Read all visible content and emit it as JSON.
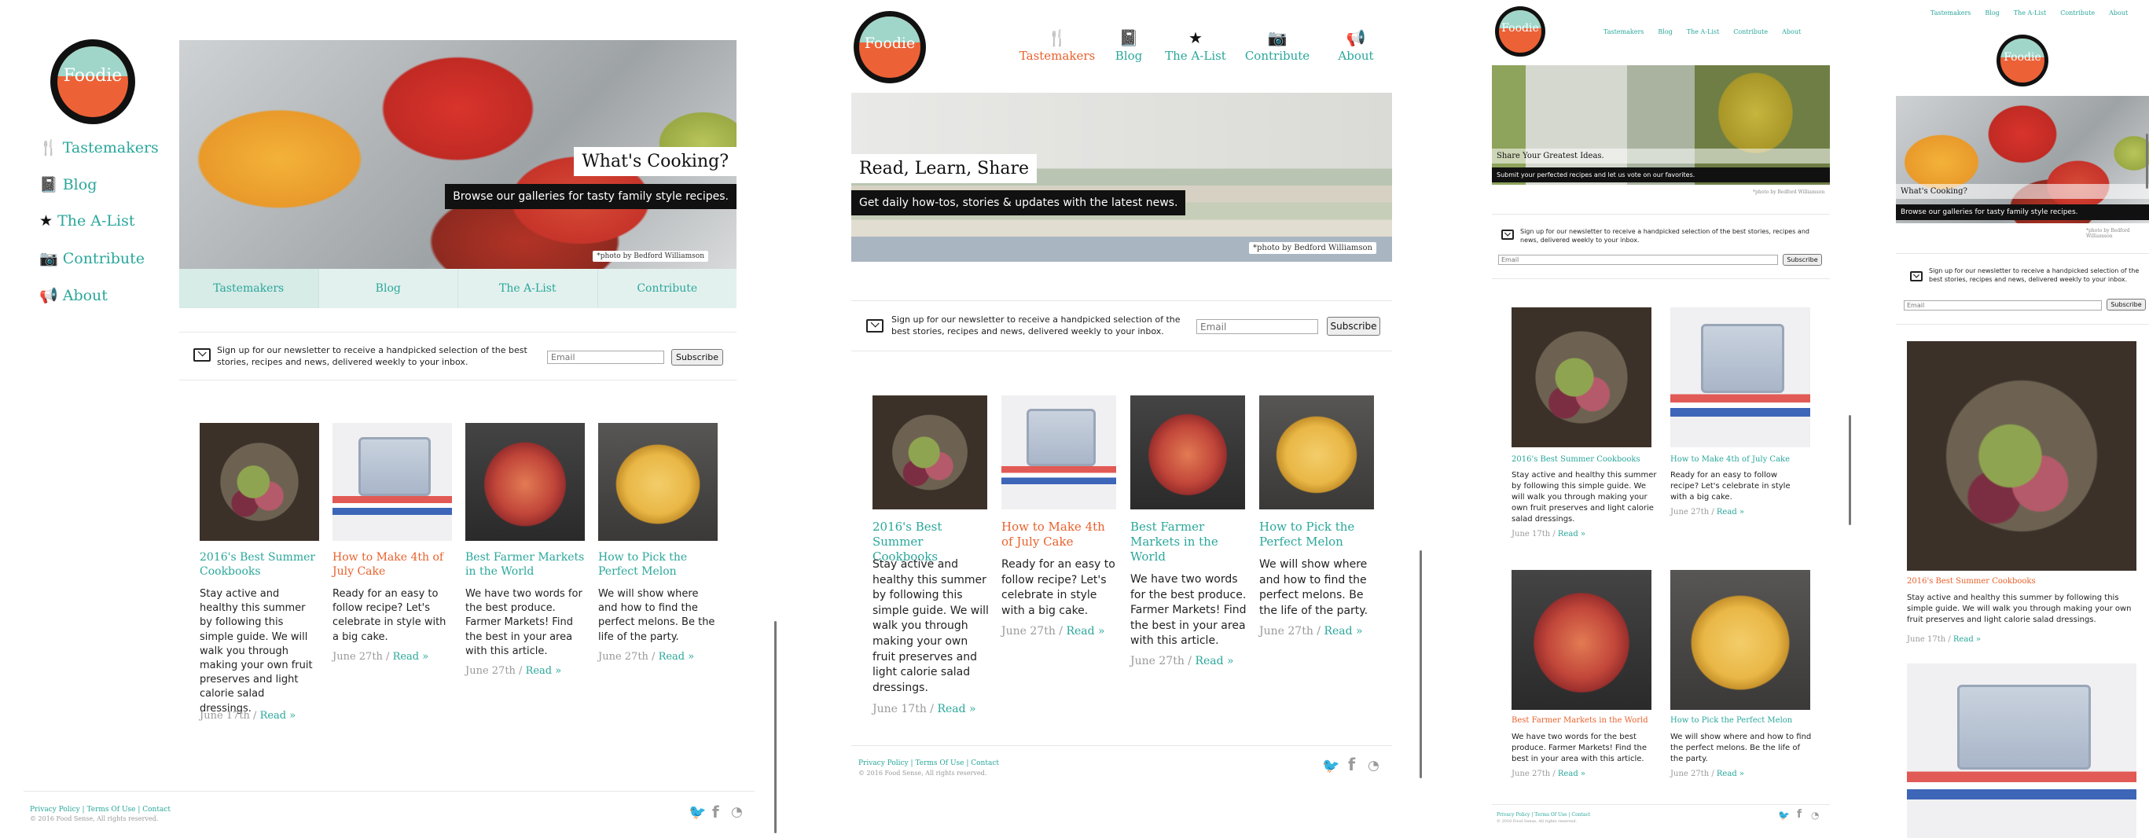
{
  "brand": {
    "logo_text": "Foodie"
  },
  "nav": [
    {
      "label": "Tastemakers",
      "icon": "utensils-icon"
    },
    {
      "label": "Blog",
      "icon": "book-icon"
    },
    {
      "label": "The A-List",
      "icon": "star-icon"
    },
    {
      "label": "Contribute",
      "icon": "camera-icon"
    },
    {
      "label": "About",
      "icon": "megaphone-icon"
    }
  ],
  "hero_home": {
    "title": "What's Cooking?",
    "subtitle": "Browse our galleries for tasty family style recipes.",
    "credit": "*photo by Bedford Williamson"
  },
  "hero_blog": {
    "title": "Read, Learn, Share",
    "subtitle": "Get daily how-tos, stories & updates with the latest news.",
    "credit": "*photo by Bedford Williamson"
  },
  "hero_contribute": {
    "title": "Share Your Greatest Ideas.",
    "subtitle": "Submit your perfected recipes and let us vote on our favorites.",
    "credit": "*photo by Bedford Williamson"
  },
  "tabs": [
    "Tastemakers",
    "Blog",
    "The A-List",
    "Contribute"
  ],
  "newsletter": {
    "text": "Sign up for our newsletter to receive a handpicked selection of the best stories, recipes and news, delivered weekly to your inbox.",
    "placeholder": "Email",
    "button": "Subscribe"
  },
  "articles": [
    {
      "title": "2016's Best Summer Cookbooks",
      "body": "Stay active and healthy this summer by following this simple guide. We will walk you through making your own fruit preserves and light calorie salad dressings.",
      "date": "June 17th",
      "read": "Read »"
    },
    {
      "title": "How to Make 4th of July Cake",
      "body": "Ready for an easy to follow recipe? Let's celebrate in style with a big cake.",
      "date": "June 27th",
      "read": "Read »"
    },
    {
      "title": "Best Farmer Markets in the World",
      "body": "We have two words for the best produce. Farmer Markets! Find the best in your area with this article.",
      "date": "June 27th",
      "read": "Read »"
    },
    {
      "title": "How to Pick the Perfect Melon",
      "body": "We will show where and how to find the perfect melons. Be the life of the party.",
      "date": "June 27th",
      "read": "Read »"
    }
  ],
  "footer": {
    "links": [
      "Privacy Policy",
      "Terms Of Use",
      "Contact"
    ],
    "separator": " | ",
    "copyright": "© 2016 Food Sense, All rights reserved."
  },
  "social": [
    "twitter-icon",
    "facebook-icon",
    "rss-icon"
  ],
  "colors": {
    "accent": "#2aa79b",
    "highlight": "#e8612c",
    "logo_top": "#9fd6c9",
    "logo_bottom": "#ec6236"
  }
}
